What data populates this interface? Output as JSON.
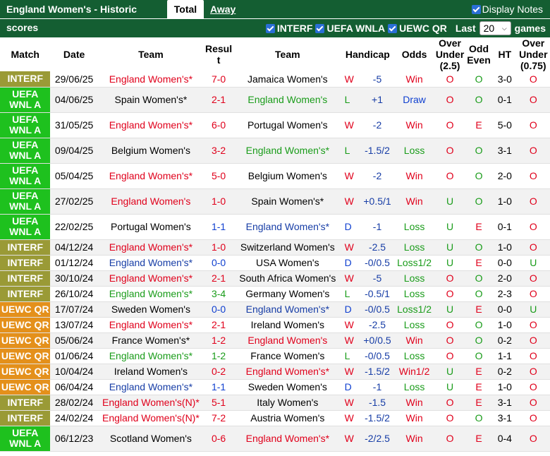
{
  "tabs": {
    "title": "England Women's - Historic scores",
    "total": "Total",
    "away": "Away",
    "display_notes": "Display Notes"
  },
  "filters": {
    "items": [
      "INTERF",
      "UEFA WNLA",
      "UEWC QR"
    ],
    "last_label": "Last",
    "last_value": "20",
    "games_label": "games"
  },
  "headers": [
    "Match",
    "Date",
    "Team",
    "Resul t",
    "Team",
    "Handicap",
    "Odds",
    "Over Under (2.5)",
    "Odd Even",
    "HT",
    "Over Under (0.75)"
  ],
  "colors": {
    "interf": "#9a9a36",
    "uefa": "#1ec11e",
    "uewc": "#e4901b",
    "header_bg": "#145e32",
    "win": "#e0001b",
    "lose": "#1a9c1a",
    "draw": "#1040d0"
  },
  "rows": [
    {
      "comp": "INTERF",
      "ctype": "interf",
      "date": "29/06/25",
      "home": "England Women's*",
      "hc": "red",
      "score": "7-0",
      "sc": "red",
      "away": "Jamaica Women's",
      "ac": "",
      "res": "W",
      "hcap": "-5",
      "odds": "Win",
      "oc": "red",
      "ou": "O",
      "oe": "O",
      "ht": "3-0",
      "ou2": "O"
    },
    {
      "comp": "UEFA WNL A",
      "ctype": "uefa",
      "date": "04/06/25",
      "home": "Spain Women's*",
      "hc": "",
      "score": "2-1",
      "sc": "red",
      "away": "England Women's",
      "ac": "green",
      "res": "L",
      "hcap": "+1",
      "odds": "Draw",
      "oc": "blue",
      "ou": "O",
      "oe": "O",
      "ht": "0-1",
      "ou2": "O"
    },
    {
      "comp": "UEFA WNL A",
      "ctype": "uefa",
      "date": "31/05/25",
      "home": "England Women's*",
      "hc": "red",
      "score": "6-0",
      "sc": "red",
      "away": "Portugal Women's",
      "ac": "",
      "res": "W",
      "hcap": "-2",
      "odds": "Win",
      "oc": "red",
      "ou": "O",
      "oe": "E",
      "ht": "5-0",
      "ou2": "O"
    },
    {
      "comp": "UEFA WNL A",
      "ctype": "uefa",
      "date": "09/04/25",
      "home": "Belgium Women's",
      "hc": "",
      "score": "3-2",
      "sc": "red",
      "away": "England Women's*",
      "ac": "green",
      "res": "L",
      "hcap": "-1.5/2",
      "odds": "Loss",
      "oc": "green",
      "ou": "O",
      "oe": "O",
      "ht": "3-1",
      "ou2": "O"
    },
    {
      "comp": "UEFA WNL A",
      "ctype": "uefa",
      "date": "05/04/25",
      "home": "England Women's*",
      "hc": "red",
      "score": "5-0",
      "sc": "red",
      "away": "Belgium Women's",
      "ac": "",
      "res": "W",
      "hcap": "-2",
      "odds": "Win",
      "oc": "red",
      "ou": "O",
      "oe": "O",
      "ht": "2-0",
      "ou2": "O"
    },
    {
      "comp": "UEFA WNL A",
      "ctype": "uefa",
      "date": "27/02/25",
      "home": "England Women's",
      "hc": "red",
      "score": "1-0",
      "sc": "red",
      "away": "Spain Women's*",
      "ac": "",
      "res": "W",
      "hcap": "+0.5/1",
      "odds": "Win",
      "oc": "red",
      "ou": "U",
      "oe": "O",
      "ht": "1-0",
      "ou2": "O"
    },
    {
      "comp": "UEFA WNL A",
      "ctype": "uefa",
      "date": "22/02/25",
      "home": "Portugal Women's",
      "hc": "",
      "score": "1-1",
      "sc": "blue",
      "away": "England Women's*",
      "ac": "darkblue",
      "res": "D",
      "hcap": "-1",
      "odds": "Loss",
      "oc": "green",
      "ou": "U",
      "oe": "E",
      "ht": "0-1",
      "ou2": "O"
    },
    {
      "comp": "INTERF",
      "ctype": "interf",
      "date": "04/12/24",
      "home": "England Women's*",
      "hc": "red",
      "score": "1-0",
      "sc": "red",
      "away": "Switzerland Women's",
      "ac": "",
      "res": "W",
      "hcap": "-2.5",
      "odds": "Loss",
      "oc": "green",
      "ou": "U",
      "oe": "O",
      "ht": "1-0",
      "ou2": "O"
    },
    {
      "comp": "INTERF",
      "ctype": "interf",
      "date": "01/12/24",
      "home": "England Women's*",
      "hc": "darkblue",
      "score": "0-0",
      "sc": "blue",
      "away": "USA Women's",
      "ac": "",
      "res": "D",
      "hcap": "-0/0.5",
      "odds": "Loss1/2",
      "oc": "green",
      "ou": "U",
      "oe": "E",
      "ht": "0-0",
      "ou2": "U"
    },
    {
      "comp": "INTERF",
      "ctype": "interf",
      "date": "30/10/24",
      "home": "England Women's*",
      "hc": "red",
      "score": "2-1",
      "sc": "red",
      "away": "South Africa Women's",
      "ac": "",
      "res": "W",
      "hcap": "-5",
      "odds": "Loss",
      "oc": "green",
      "ou": "O",
      "oe": "O",
      "ht": "2-0",
      "ou2": "O"
    },
    {
      "comp": "INTERF",
      "ctype": "interf",
      "date": "26/10/24",
      "home": "England Women's*",
      "hc": "green",
      "score": "3-4",
      "sc": "green",
      "away": "Germany Women's",
      "ac": "",
      "res": "L",
      "hcap": "-0.5/1",
      "odds": "Loss",
      "oc": "green",
      "ou": "O",
      "oe": "O",
      "ht": "2-3",
      "ou2": "O"
    },
    {
      "comp": "UEWC QR",
      "ctype": "uewc",
      "date": "17/07/24",
      "home": "Sweden Women's",
      "hc": "",
      "score": "0-0",
      "sc": "blue",
      "away": "England Women's*",
      "ac": "darkblue",
      "res": "D",
      "hcap": "-0/0.5",
      "odds": "Loss1/2",
      "oc": "green",
      "ou": "U",
      "oe": "E",
      "ht": "0-0",
      "ou2": "U"
    },
    {
      "comp": "UEWC QR",
      "ctype": "uewc",
      "date": "13/07/24",
      "home": "England Women's*",
      "hc": "red",
      "score": "2-1",
      "sc": "red",
      "away": "Ireland Women's",
      "ac": "",
      "res": "W",
      "hcap": "-2.5",
      "odds": "Loss",
      "oc": "green",
      "ou": "O",
      "oe": "O",
      "ht": "1-0",
      "ou2": "O"
    },
    {
      "comp": "UEWC QR",
      "ctype": "uewc",
      "date": "05/06/24",
      "home": "France Women's*",
      "hc": "",
      "score": "1-2",
      "sc": "red",
      "away": "England Women's",
      "ac": "red",
      "res": "W",
      "hcap": "+0/0.5",
      "odds": "Win",
      "oc": "red",
      "ou": "O",
      "oe": "O",
      "ht": "0-2",
      "ou2": "O"
    },
    {
      "comp": "UEWC QR",
      "ctype": "uewc",
      "date": "01/06/24",
      "home": "England Women's*",
      "hc": "green",
      "score": "1-2",
      "sc": "green",
      "away": "France Women's",
      "ac": "",
      "res": "L",
      "hcap": "-0/0.5",
      "odds": "Loss",
      "oc": "green",
      "ou": "O",
      "oe": "O",
      "ht": "1-1",
      "ou2": "O"
    },
    {
      "comp": "UEWC QR",
      "ctype": "uewc",
      "date": "10/04/24",
      "home": "Ireland Women's",
      "hc": "",
      "score": "0-2",
      "sc": "red",
      "away": "England Women's*",
      "ac": "red",
      "res": "W",
      "hcap": "-1.5/2",
      "odds": "Win1/2",
      "oc": "red",
      "ou": "U",
      "oe": "E",
      "ht": "0-2",
      "ou2": "O"
    },
    {
      "comp": "UEWC QR",
      "ctype": "uewc",
      "date": "06/04/24",
      "home": "England Women's*",
      "hc": "darkblue",
      "score": "1-1",
      "sc": "blue",
      "away": "Sweden Women's",
      "ac": "",
      "res": "D",
      "hcap": "-1",
      "odds": "Loss",
      "oc": "green",
      "ou": "U",
      "oe": "E",
      "ht": "1-0",
      "ou2": "O"
    },
    {
      "comp": "INTERF",
      "ctype": "interf",
      "date": "28/02/24",
      "home": "England Women's(N)*",
      "hc": "red",
      "score": "5-1",
      "sc": "red",
      "away": "Italy Women's",
      "ac": "",
      "res": "W",
      "hcap": "-1.5",
      "odds": "Win",
      "oc": "red",
      "ou": "O",
      "oe": "E",
      "ht": "3-1",
      "ou2": "O"
    },
    {
      "comp": "INTERF",
      "ctype": "interf",
      "date": "24/02/24",
      "home": "England Women's(N)*",
      "hc": "red",
      "score": "7-2",
      "sc": "red",
      "away": "Austria Women's",
      "ac": "",
      "res": "W",
      "hcap": "-1.5/2",
      "odds": "Win",
      "oc": "red",
      "ou": "O",
      "oe": "O",
      "ht": "3-1",
      "ou2": "O"
    },
    {
      "comp": "UEFA WNL A",
      "ctype": "uefa",
      "date": "06/12/23",
      "home": "Scotland Women's",
      "hc": "",
      "score": "0-6",
      "sc": "red",
      "away": "England Women's*",
      "ac": "red",
      "res": "W",
      "hcap": "-2/2.5",
      "odds": "Win",
      "oc": "red",
      "ou": "O",
      "oe": "E",
      "ht": "0-4",
      "ou2": "O"
    }
  ]
}
